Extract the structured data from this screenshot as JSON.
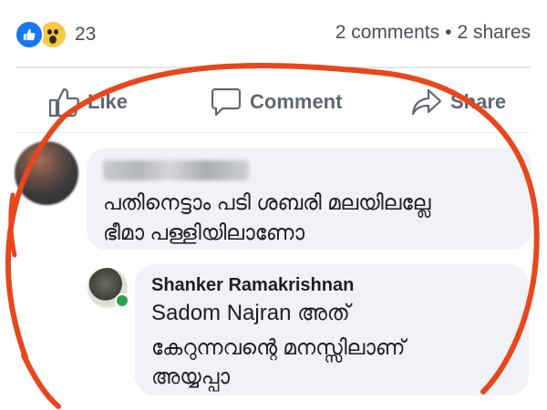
{
  "stats": {
    "reaction_icons": [
      "like-icon",
      "wow-icon"
    ],
    "reaction_count": "23",
    "comments": "2 comments",
    "separator": "•",
    "shares": "2 shares"
  },
  "actions": {
    "like": "Like",
    "comment": "Comment",
    "share": "Share"
  },
  "comments": [
    {
      "author": "",
      "author_blurred": true,
      "lines": [
        "പതിനെട്ടാം പടി  ശബരി മലയിലല്ലേ",
        "ഭീമാ പള്ളിയിലാണോ"
      ]
    },
    {
      "author": "Shanker Ramakrishnan",
      "online": true,
      "lines": [
        "Sadom Najran അത്",
        "കേറുന്നവന്റെ മനസ്സിലാണ്",
        "അയ്യപ്പാ"
      ]
    }
  ],
  "colors": {
    "brand": "#1877f2",
    "annotation": "#e8461c",
    "bubble": "#f0f2f5",
    "online": "#31a24c"
  }
}
